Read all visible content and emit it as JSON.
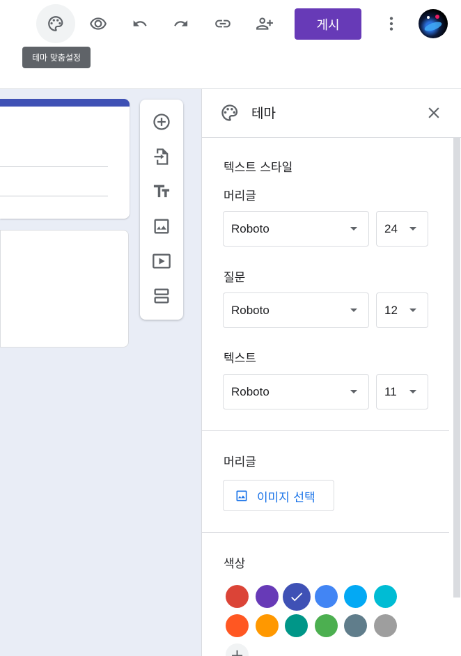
{
  "toolbar": {
    "publish_label": "게시",
    "tooltip": "테마 맞춤설정",
    "icons": [
      "palette-icon",
      "eye-icon",
      "undo-icon",
      "redo-icon",
      "link-icon",
      "add-person-icon",
      "more-vert-icon"
    ]
  },
  "theme_panel": {
    "title": "테마",
    "text_style_heading": "텍스트 스타일",
    "header_label": "머리글",
    "header_font": "Roboto",
    "header_size": "24",
    "question_label": "질문",
    "question_font": "Roboto",
    "question_size": "12",
    "text_label": "텍스트",
    "text_font": "Roboto",
    "text_size": "11",
    "header_image_label": "머리글",
    "choose_image_label": "이미지 선택",
    "color_label": "색상",
    "colors": [
      "#db4437",
      "#673ab7",
      "#3f51b5",
      "#4285f4",
      "#03a9f4",
      "#00bcd4",
      "#ff5722",
      "#ff9800",
      "#009688",
      "#4caf50",
      "#607d8b",
      "#9e9e9e"
    ],
    "selected_color": "#3f51b5"
  },
  "side_toolbox": {
    "tools": [
      "add-question-icon",
      "import-questions-icon",
      "add-title-icon",
      "add-image-icon",
      "add-video-icon",
      "add-section-icon"
    ]
  },
  "theme": {
    "accent": "#673ab7",
    "header_accent": "#3f51b5",
    "canvas_bg": "#e9edf6"
  }
}
